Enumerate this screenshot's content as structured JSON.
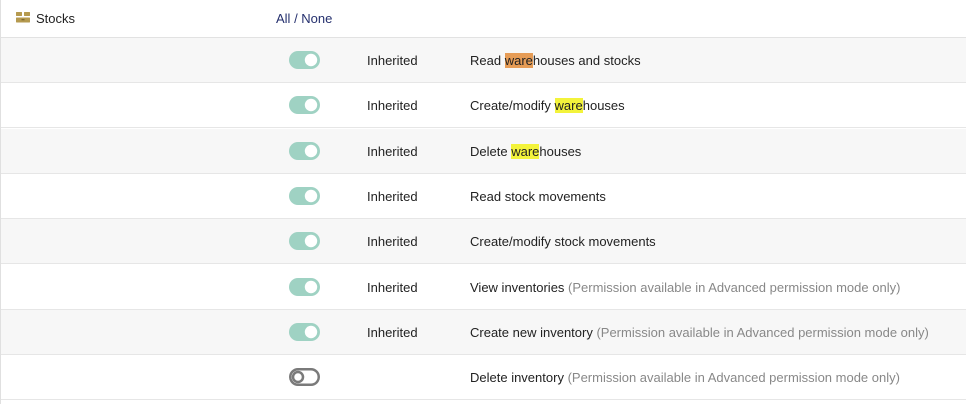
{
  "module": {
    "title": "Stocks",
    "icon": "boxes-icon",
    "icon_color": "#b59a4f",
    "all_label": "All",
    "separator": " / ",
    "none_label": "None"
  },
  "colors": {
    "toggle_on": "#9fd2c3",
    "toggle_off": "#7a7a7a",
    "highlight_current": "#e69c56",
    "highlight_match": "#f3f33b",
    "note_text": "#888888",
    "link": "#25306e"
  },
  "rows": [
    {
      "enabled": true,
      "status": "Inherited",
      "text_before": "Read ",
      "highlight": "ware",
      "highlight_style": "current",
      "text_after": "houses and stocks",
      "note": ""
    },
    {
      "enabled": true,
      "status": "Inherited",
      "text_before": "Create/modify ",
      "highlight": "ware",
      "highlight_style": "match",
      "text_after": "houses",
      "note": ""
    },
    {
      "enabled": true,
      "status": "Inherited",
      "text_before": "Delete ",
      "highlight": "ware",
      "highlight_style": "match",
      "text_after": "houses",
      "note": ""
    },
    {
      "enabled": true,
      "status": "Inherited",
      "text_before": "Read stock movements",
      "highlight": "",
      "highlight_style": "",
      "text_after": "",
      "note": ""
    },
    {
      "enabled": true,
      "status": "Inherited",
      "text_before": "Create/modify stock movements",
      "highlight": "",
      "highlight_style": "",
      "text_after": "",
      "note": ""
    },
    {
      "enabled": true,
      "status": "Inherited",
      "text_before": "View inventories",
      "highlight": "",
      "highlight_style": "",
      "text_after": "",
      "note": " (Permission available in Advanced permission mode only)"
    },
    {
      "enabled": true,
      "status": "Inherited",
      "text_before": "Create new inventory",
      "highlight": "",
      "highlight_style": "",
      "text_after": "",
      "note": " (Permission available in Advanced permission mode only)"
    },
    {
      "enabled": false,
      "status": "",
      "text_before": "Delete inventory",
      "highlight": "",
      "highlight_style": "",
      "text_after": "",
      "note": " (Permission available in Advanced permission mode only)"
    }
  ]
}
